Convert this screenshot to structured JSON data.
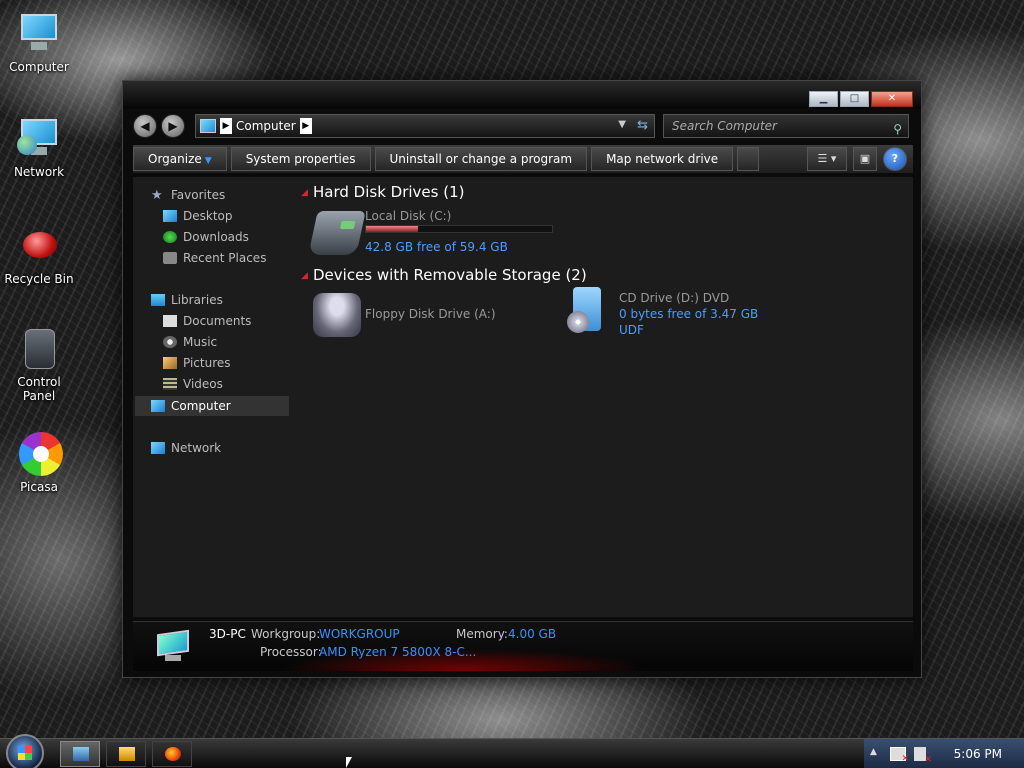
{
  "desktop": {
    "icons": [
      {
        "label": "Computer"
      },
      {
        "label": "Network"
      },
      {
        "label": "Recycle Bin"
      },
      {
        "label": "Control Panel"
      },
      {
        "label": "Picasa"
      }
    ]
  },
  "window": {
    "address": {
      "location": "Computer"
    },
    "search": {
      "placeholder": "Search Computer"
    },
    "caption_buttons": {
      "minimize": "▁",
      "maximize": "□",
      "close": "✕"
    },
    "toolbar": {
      "organize": "Organize",
      "system_properties": "System properties",
      "uninstall": "Uninstall or change a program",
      "map_drive": "Map network drive",
      "help": "?"
    },
    "nav": {
      "favorites": "Favorites",
      "desktop": "Desktop",
      "downloads": "Downloads",
      "recent_places": "Recent Places",
      "libraries": "Libraries",
      "documents": "Documents",
      "music": "Music",
      "pictures": "Pictures",
      "videos": "Videos",
      "computer": "Computer",
      "network": "Network"
    },
    "groups": {
      "hard_disk": "Hard Disk Drives (1)",
      "removable": "Devices with Removable Storage (2)"
    },
    "drives": {
      "c": {
        "name": "Local Disk (C:)",
        "free": "42.8 GB free of 59.4 GB",
        "used_fraction": 0.279
      },
      "a": {
        "name": "Floppy Disk Drive (A:)"
      },
      "d": {
        "name": "CD Drive (D:) DVD",
        "free": "0 bytes free of 3.47 GB",
        "fs": "UDF"
      }
    },
    "details": {
      "pc_name": "3D-PC",
      "workgroup_label": "Workgroup:",
      "workgroup": "WORKGROUP",
      "memory_label": "Memory:",
      "memory": "4.00 GB",
      "processor_label": "Processor:",
      "processor": "AMD Ryzen 7 5800X 8-C..."
    }
  },
  "taskbar": {
    "clock": "5:06 PM"
  },
  "colors": {
    "link_blue": "#4a9eff",
    "close_red": "#c0321e"
  }
}
